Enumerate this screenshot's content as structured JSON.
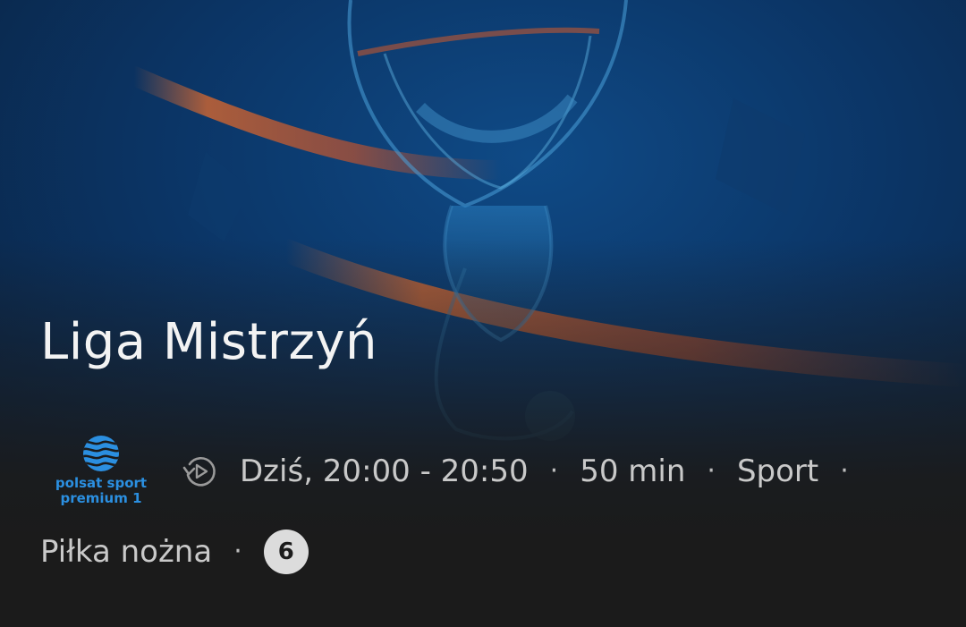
{
  "program": {
    "title": "Liga Mistrzyń"
  },
  "channel": {
    "name_line1": "polsat sport",
    "name_line2": "premium 1",
    "logo_icon": "polsat-waves-logo",
    "brand_color": "#2b8fe0"
  },
  "meta": {
    "replay_icon": "replay-icon",
    "airtime": "Dziś, 20:00 - 20:50",
    "duration": "50 min",
    "category": "Sport",
    "subcategory": "Piłka nożna",
    "separator": "·",
    "age_rating": "6"
  },
  "colors": {
    "background": "#1b1b1b",
    "hero_blue": "#0d3b6e",
    "accent_orange": "#d8602a",
    "text_primary": "#f3f3f3",
    "text_secondary": "#c9c9c9"
  }
}
